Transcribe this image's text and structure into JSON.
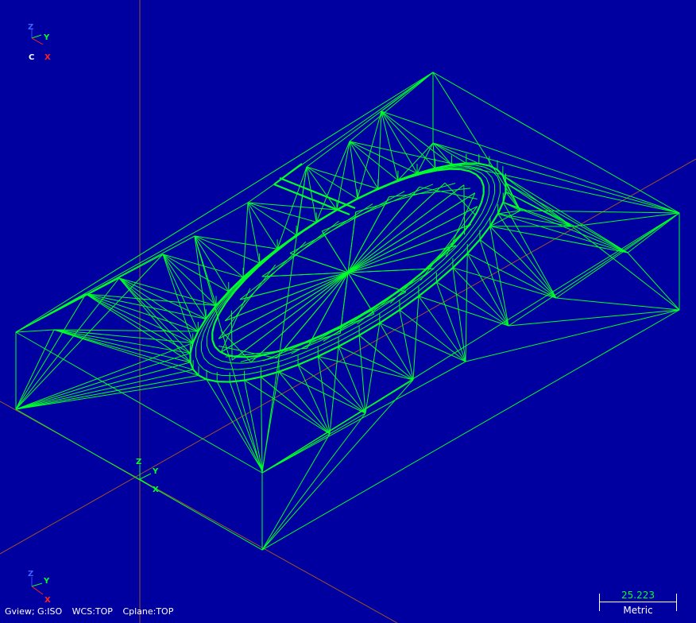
{
  "viewport": {
    "background": "#0000a0",
    "wire_color": "#00ff28",
    "axis_color": "#a0522d"
  },
  "top_gnomon": {
    "z": "Z",
    "y": "Y",
    "c": "C",
    "x": "X"
  },
  "origin_gnomon": {
    "z": "Z",
    "y": "Y",
    "x": "X"
  },
  "bottom_gnomon": {
    "z": "Z",
    "y": "Y",
    "x": "X"
  },
  "status": {
    "gview": "Gview; G:ISO",
    "wcs": "WCS:TOP",
    "cplane": "Cplane:TOP"
  },
  "scale": {
    "value": "25.223",
    "unit": "Metric"
  }
}
